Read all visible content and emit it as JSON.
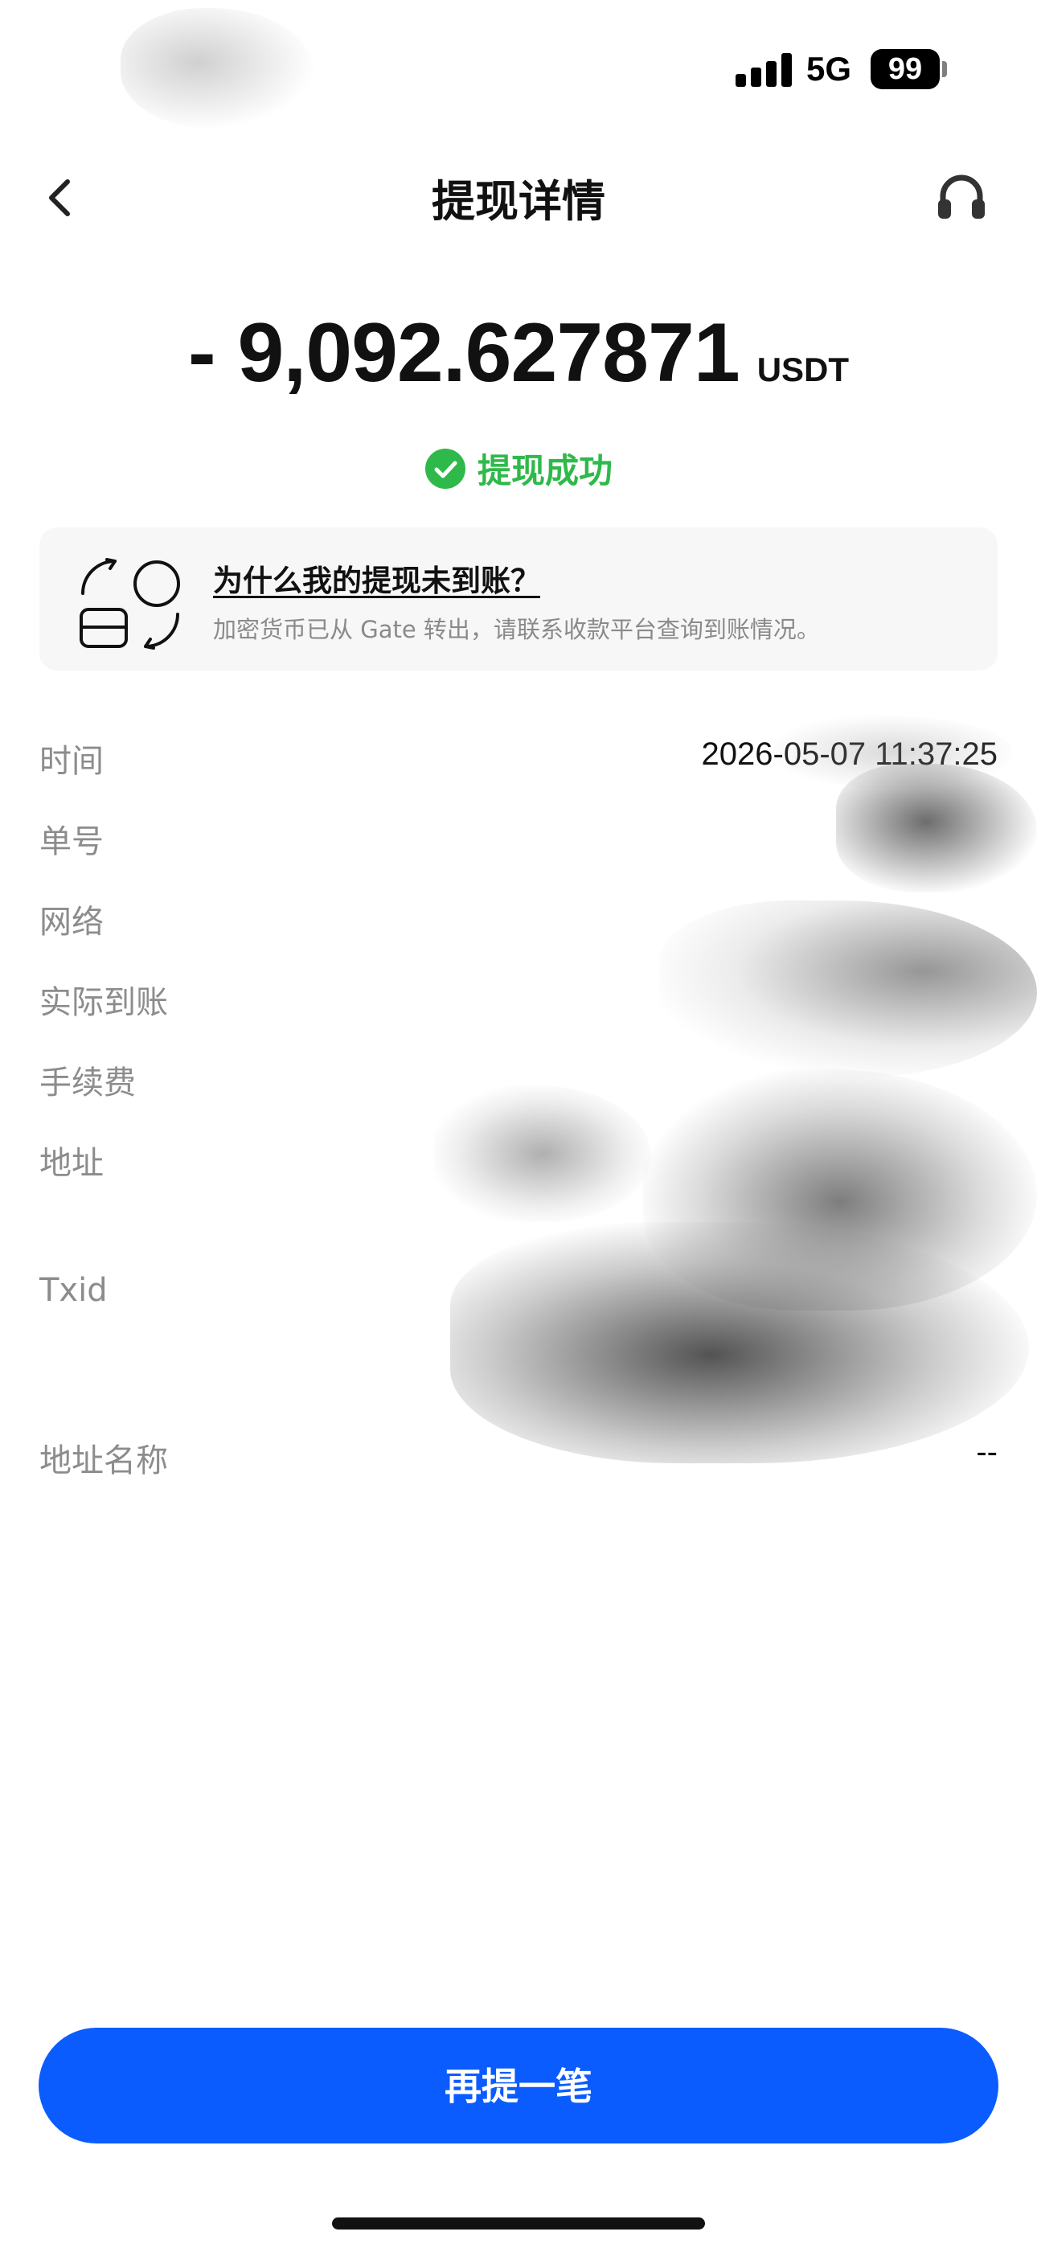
{
  "status_bar": {
    "network": "5G",
    "battery": "99"
  },
  "nav": {
    "title": "提现详情",
    "back_icon": "chevron-left-icon",
    "support_icon": "headphones-icon"
  },
  "amount": {
    "value": "- 9,092.627871",
    "unit": "USDT"
  },
  "status": {
    "icon": "check-circle-icon",
    "text": "提现成功",
    "color": "#2fb94a"
  },
  "info_card": {
    "icon": "refresh-wallet-icon",
    "title": "为什么我的提现未到账？",
    "description": "加密货币已从 Gate 转出，请联系收款平台查询到账情况。"
  },
  "details": {
    "time": {
      "label": "时间",
      "value": "2026-05-07 11:37:25"
    },
    "order_id": {
      "label": "单号"
    },
    "network": {
      "label": "网络"
    },
    "actual_received": {
      "label": "实际到账"
    },
    "fee": {
      "label": "手续费"
    },
    "address": {
      "label": "地址"
    },
    "txid": {
      "label": "Txid"
    },
    "address_name": {
      "label": "地址名称",
      "value": "--"
    }
  },
  "actions": {
    "primary": "再提一笔"
  },
  "colors": {
    "primary": "#0a5cff",
    "success": "#2fb94a",
    "label_gray": "#8c8c8c",
    "card_bg": "#f7f7f7"
  }
}
